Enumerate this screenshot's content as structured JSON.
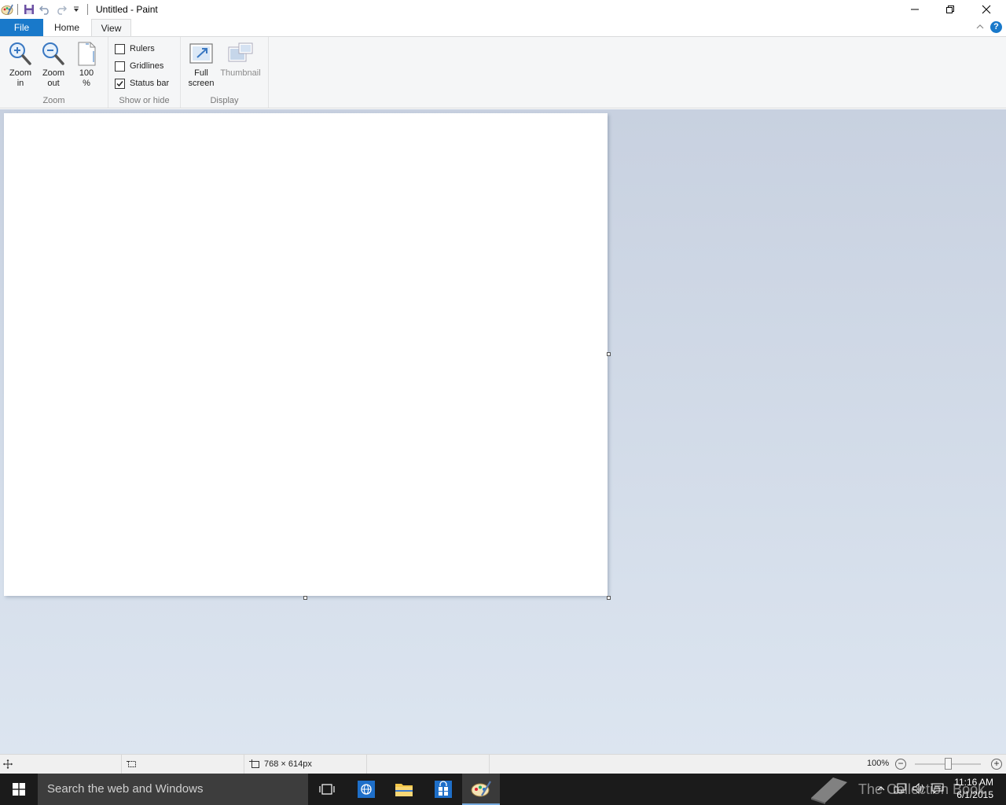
{
  "titlebar": {
    "title": "Untitled - Paint",
    "qat_icons": [
      "paint-app-icon",
      "save-icon",
      "undo-icon",
      "redo-icon",
      "customize-qat-icon"
    ],
    "controls": [
      "minimize",
      "restore",
      "close"
    ]
  },
  "tabs": [
    {
      "label": "File"
    },
    {
      "label": "Home"
    },
    {
      "label": "View",
      "active": true
    }
  ],
  "help": "?",
  "ribbon": {
    "zoom_group": {
      "label": "Zoom",
      "zoom_in": {
        "line1": "Zoom",
        "line2": "in"
      },
      "zoom_out": {
        "line1": "Zoom",
        "line2": "out"
      },
      "actual_size": {
        "line1": "100",
        "line2": "%"
      }
    },
    "show_hide_group": {
      "label": "Show or hide",
      "rulers": {
        "label": "Rulers",
        "checked": false
      },
      "gridlines": {
        "label": "Gridlines",
        "checked": false
      },
      "status_bar": {
        "label": "Status bar",
        "checked": true
      }
    },
    "display_group": {
      "label": "Display",
      "full_screen": {
        "line1": "Full",
        "line2": "screen"
      },
      "thumbnail": {
        "label": "Thumbnail",
        "enabled": false
      }
    }
  },
  "status": {
    "image_size": "768 × 614px",
    "zoom_level": "100%",
    "zoom_minus": "−",
    "zoom_plus": "+"
  },
  "taskbar": {
    "search_placeholder": "Search the web and Windows",
    "time": "11:16 AM",
    "date": "6/1/2015",
    "watermark": "The Collection Book"
  },
  "colors": {
    "accent": "#1979ca",
    "ribbon_bg": "#f5f6f7",
    "workspace_top": "#c8d1e0",
    "workspace_bottom": "#dce5f0",
    "taskbar_bg": "#1b1b1b"
  }
}
